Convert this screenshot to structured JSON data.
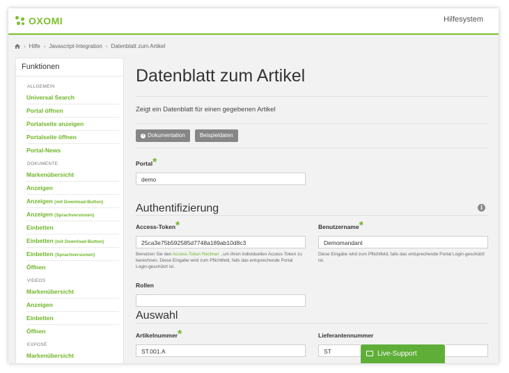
{
  "header": {
    "logo": "OXOMI",
    "help": "Hilfesystem"
  },
  "breadcrumb": [
    "Hilfe",
    "Javascript-Integration",
    "Datenblatt zum Artikel"
  ],
  "sidebar": {
    "title": "Funktionen",
    "sections": [
      {
        "label": "ALLGEMEIN",
        "items": [
          {
            "label": "Universal Search",
            "sub": ""
          },
          {
            "label": "Portal öffnen",
            "sub": ""
          },
          {
            "label": "Portalseite anzeigen",
            "sub": ""
          },
          {
            "label": "Portalseite öffnen",
            "sub": ""
          },
          {
            "label": "Portal-News",
            "sub": ""
          }
        ]
      },
      {
        "label": "DOKUMENTE",
        "items": [
          {
            "label": "Markenübersicht",
            "sub": ""
          },
          {
            "label": "Anzeigen",
            "sub": ""
          },
          {
            "label": "Anzeigen",
            "sub": "(mit Download-Button)"
          },
          {
            "label": "Anzeigen",
            "sub": "(Sprachversionen)"
          },
          {
            "label": "Einbetten",
            "sub": ""
          },
          {
            "label": "Einbetten",
            "sub": "(mit Download-Button)"
          },
          {
            "label": "Einbetten",
            "sub": "(Sprachversionen)"
          },
          {
            "label": "Öffnen",
            "sub": ""
          }
        ]
      },
      {
        "label": "VIDEOS",
        "items": [
          {
            "label": "Markenübersicht",
            "sub": ""
          },
          {
            "label": "Anzeigen",
            "sub": ""
          },
          {
            "label": "Einbetten",
            "sub": ""
          },
          {
            "label": "Öffnen",
            "sub": ""
          }
        ]
      },
      {
        "label": "EXPOSÉ",
        "items": [
          {
            "label": "Markenübersicht",
            "sub": ""
          }
        ]
      }
    ]
  },
  "main": {
    "title": "Datenblatt zum Artikel",
    "description": "Zeigt ein Datenblatt für einen gegebenen Artikel",
    "buttons": {
      "docs": "Dokumentation",
      "examples": "Beispieldaten"
    },
    "portal": {
      "label": "Portal",
      "value": "demo"
    },
    "auth": {
      "title": "Authentifizierung",
      "token_label": "Access-Token",
      "token_value": "25ca3e75b592585d7748a189ab10d8c3",
      "token_help_pre": "Benutzen Sie den",
      "token_help_link": "Access-Token Rechner",
      "token_help_post": ", um Ihren individuellen Access-Token zu berechnen. Diese Eingabe wird zum Pflichtfeld, falls das entsprechende Portal Login-geschützt ist.",
      "user_label": "Benutzername",
      "user_value": "Demomandant",
      "user_help": "Diese Eingabe wird zum Pflichtfeld, falls das entsprechende Portal Login-geschützt ist.",
      "roles_label": "Rollen",
      "roles_value": ""
    },
    "selection": {
      "title": "Auswahl",
      "article_label": "Artikelnummer",
      "article_value": "ST.001.A",
      "supplier_label": "Lieferantennummer",
      "supplier_value": "ST"
    }
  },
  "live_support": "Live-Support",
  "colors": {
    "accent": "#6db527",
    "button": "#868686"
  }
}
